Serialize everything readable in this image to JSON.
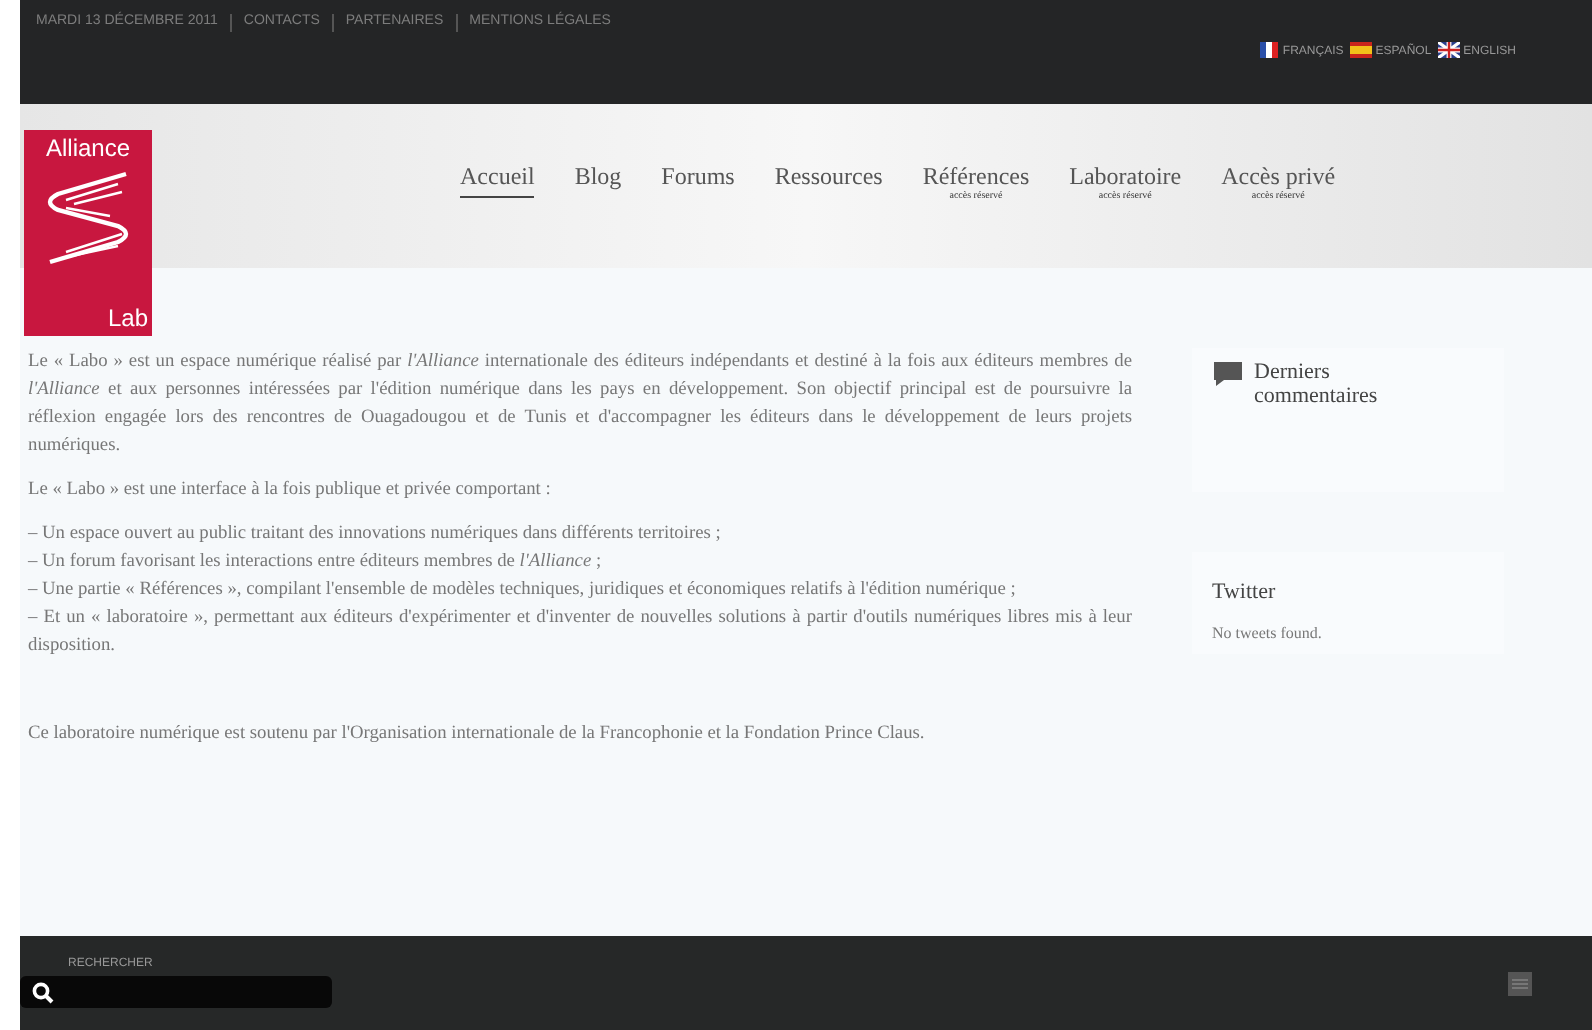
{
  "top_bar": {
    "links": [
      "MARDI 13 DÉCEMBRE 2011",
      "CONTACTS",
      "PARTENAIRES",
      "MENTIONS LÉGALES"
    ],
    "languages": [
      {
        "label": "FRANÇAIS",
        "kind": "fr"
      },
      {
        "label": "ESPAÑOL",
        "kind": "es"
      },
      {
        "label": "ENGLISH",
        "kind": "en"
      }
    ]
  },
  "logo": {
    "top": "Alliance",
    "bottom": "Lab"
  },
  "nav": [
    {
      "label": "Accueil",
      "selected": true
    },
    {
      "label": "Blog",
      "selected": false
    },
    {
      "label": "Forums",
      "selected": false
    },
    {
      "label": "Ressources",
      "selected": false
    },
    {
      "label": "Références",
      "note": "accès réservé",
      "selected": false
    },
    {
      "label": "Laboratoire",
      "note": "accès réservé",
      "selected": false
    },
    {
      "label": "Accès privé",
      "note": "accès réservé",
      "selected": false
    }
  ],
  "main": {
    "paragraphs": [
      {
        "kind": "para",
        "text": "Le « Labo » est un espace numérique réalisé par *l'Alliance* internationale des éditeurs indépendants et destiné à la fois aux éditeurs membres de *l'Alliance* et aux personnes intéressées par l'édition numérique dans les pays en développement. Son objectif principal est de poursuivre la réflexion engagée lors des rencontres de Ouagadougou et de Tunis et d'accompagner les éditeurs dans le développement de leurs projets numériques."
      },
      {
        "kind": "para",
        "text": "Le « Labo » est une interface à la fois publique et privée comportant :"
      },
      {
        "kind": "list",
        "items": [
          "– Un espace ouvert au public traitant des innovations numériques dans différents territoires ;",
          "– Un forum favorisant les interactions entre éditeurs membres de *l'Alliance* ;",
          "– Une partie « Références », compilant l'ensemble de modèles techniques, juridiques et économiques relatifs à l'édition numérique ;",
          "– Et un « laboratoire », permettant aux éditeurs d'expérimenter et d'inventer de nouvelles solutions à partir d'outils numériques libres mis à leur disposition."
        ]
      },
      {
        "kind": "note",
        "text": "Ce laboratoire numérique est soutenu par l'Organisation internationale de la Francophonie et la Fondation Prince Claus."
      }
    ]
  },
  "sidebar": [
    {
      "kind": "comments",
      "title": "Derniers commentaires"
    },
    {
      "kind": "twitter",
      "title": "Twitter",
      "text": "No tweets found."
    }
  ],
  "footer": {
    "search_label": "RECHERCHER"
  }
}
